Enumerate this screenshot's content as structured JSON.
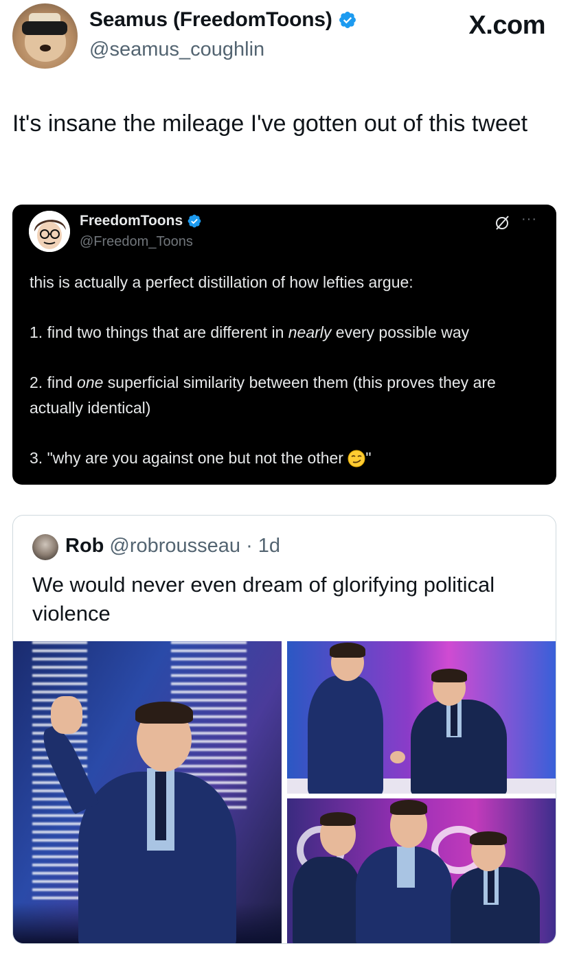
{
  "header": {
    "display_name": "Seamus (FreedomToons)",
    "handle": "@seamus_coughlin",
    "brand": "X.com",
    "verified_color": "#1d9bf0"
  },
  "tweet": {
    "text": "It's insane the mileage I've gotten out of this tweet"
  },
  "embedded_tweet": {
    "display_name": "FreedomToons",
    "handle": "@Freedom_Toons",
    "more_label": "···",
    "line_intro": "this is actually a perfect distillation of how lefties argue:",
    "item1_before": "1. find two things that are different in ",
    "item1_em": "nearly",
    "item1_after": " every possible way",
    "item2_before": "2. find ",
    "item2_em": "one",
    "item2_after": " superficial similarity between them (this proves they are actually identical)",
    "item3_before": "3. \"why are you against one but not the other ",
    "item3_after": "\"",
    "emoji": "smirking-face"
  },
  "quoted_tweet": {
    "name": "Rob",
    "handle_time": "@robrousseau · 1d",
    "text": "We would never even dream of glorifying political violence",
    "photos": [
      "photo-waving-on-stage",
      "photo-handshake",
      "photo-group-on-stage"
    ]
  }
}
